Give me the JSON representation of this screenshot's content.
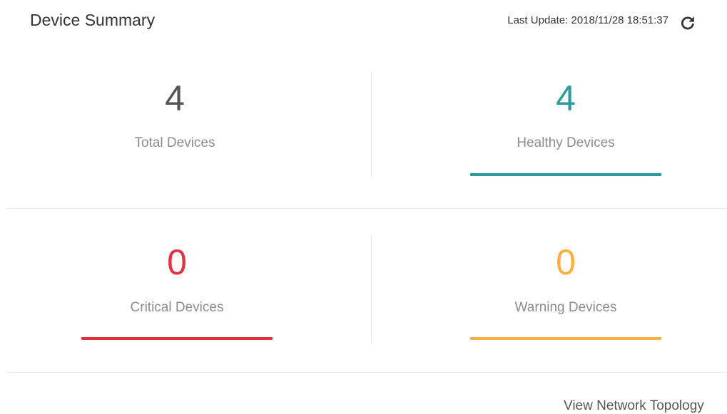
{
  "header": {
    "title": "Device Summary",
    "last_update": "Last Update: 2018/11/28 18:51:37",
    "refresh_icon": "refresh-icon"
  },
  "stats": {
    "total": {
      "value": "4",
      "label": "Total Devices",
      "color": "#555555"
    },
    "healthy": {
      "value": "4",
      "label": "Healthy Devices",
      "color": "#2e9a9a"
    },
    "critical": {
      "value": "0",
      "label": "Critical Devices",
      "color": "#e0323f"
    },
    "warning": {
      "value": "0",
      "label": "Warning Devices",
      "color": "#fbb040"
    }
  },
  "footer": {
    "link": "View Network Topology"
  }
}
